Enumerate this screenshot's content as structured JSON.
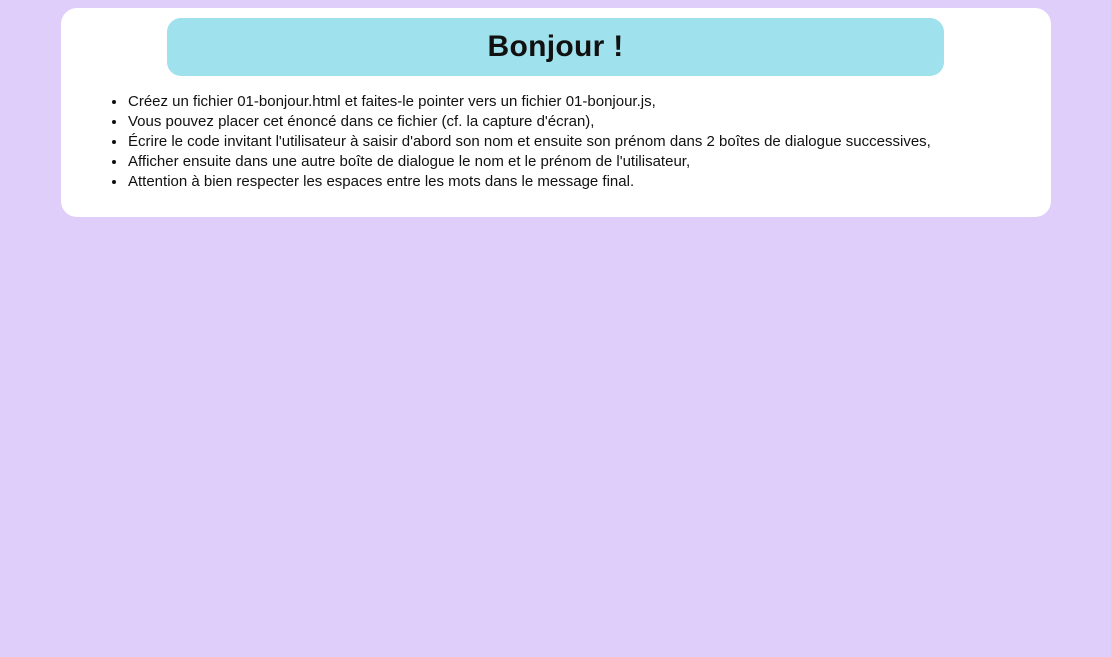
{
  "page": {
    "background_color": "#dfcdfa",
    "card_color": "#ffffff",
    "title_box_color": "#9fe1ec"
  },
  "header": {
    "title": "Bonjour !"
  },
  "instructions": [
    "Créez un fichier 01-bonjour.html et faites-le pointer vers un fichier 01-bonjour.js,",
    "Vous pouvez placer cet énoncé dans ce fichier (cf. la capture d'écran),",
    "Écrire le code invitant l'utilisateur à saisir d'abord son nom et ensuite son prénom dans 2 boîtes de dialogue successives,",
    "Afficher ensuite dans une autre boîte de dialogue le nom et le prénom de l'utilisateur,",
    "Attention à bien respecter les espaces entre les mots dans le message final."
  ]
}
